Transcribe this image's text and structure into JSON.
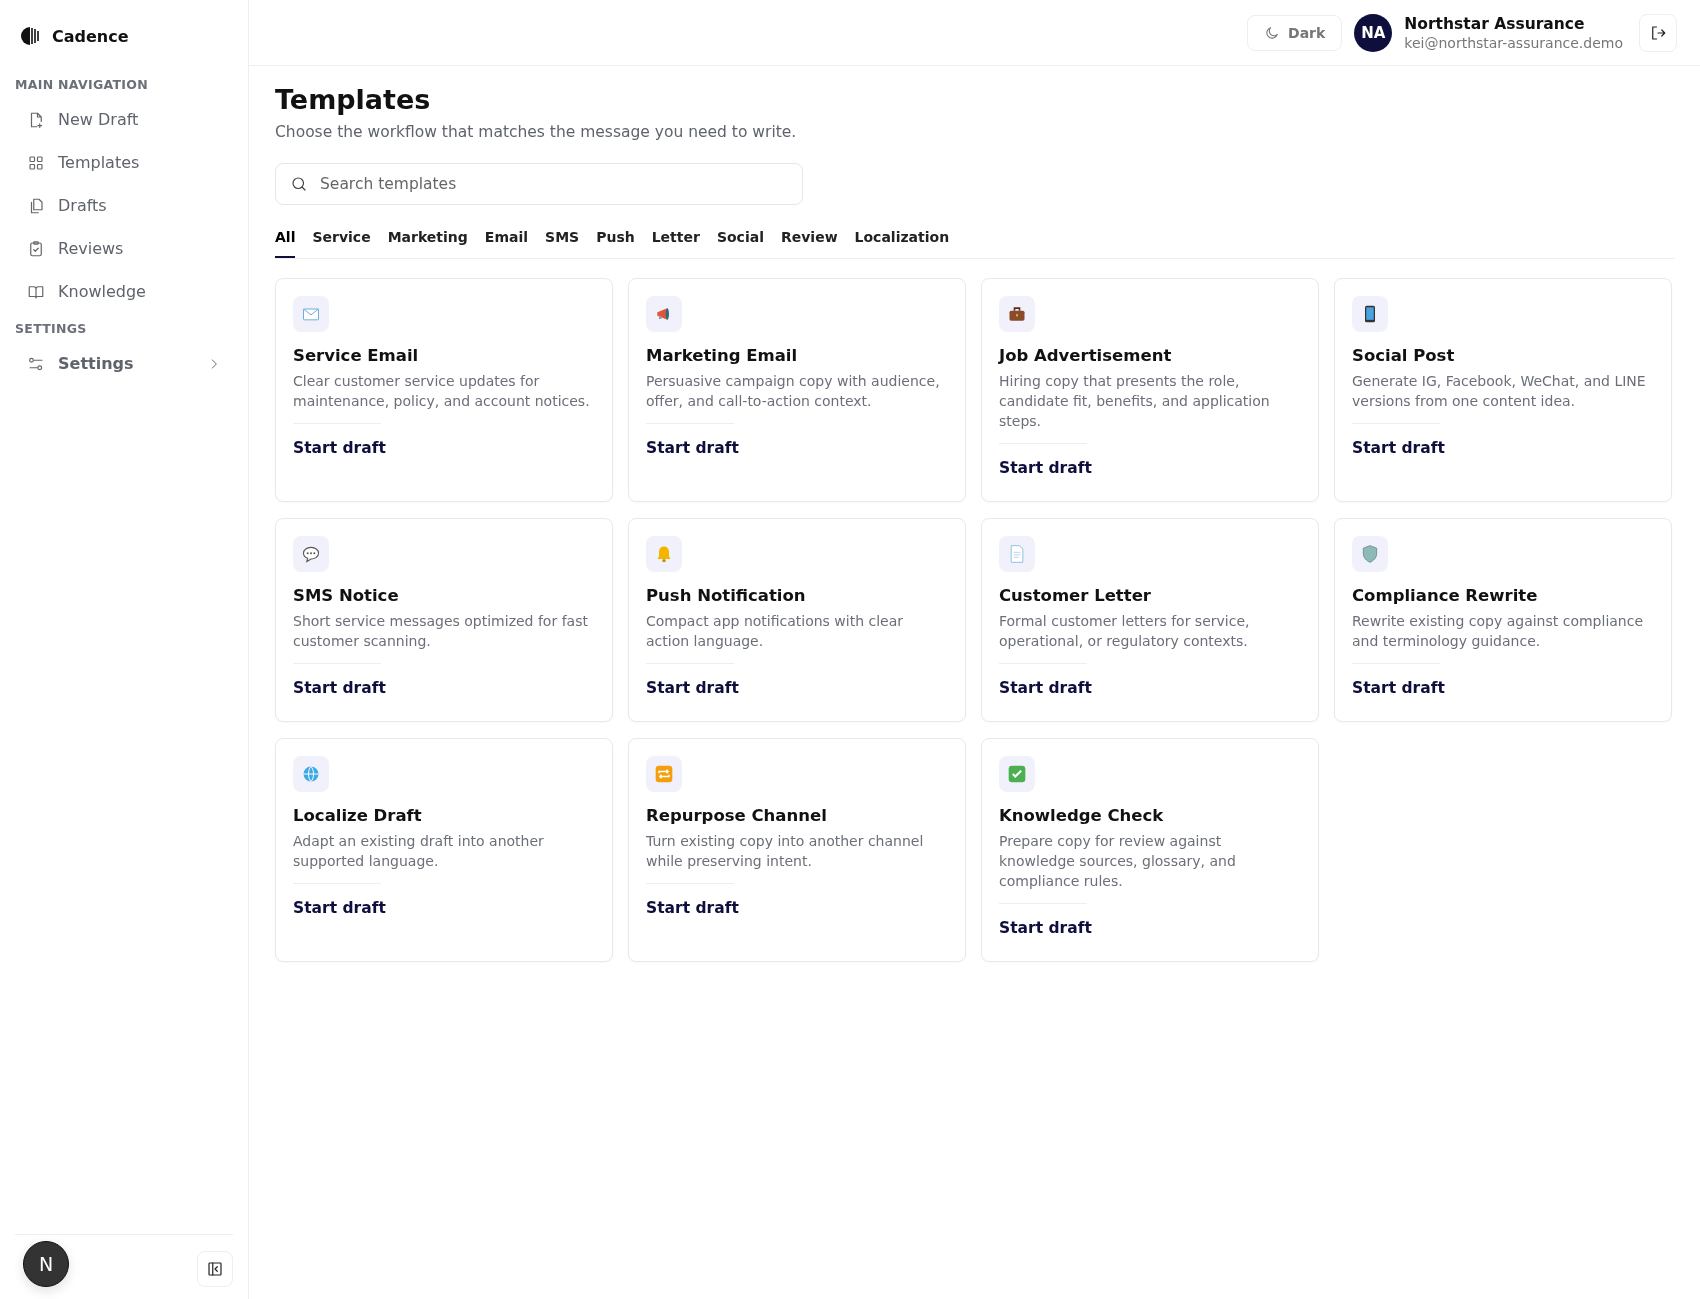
{
  "sidebar": {
    "brand": "Cadence",
    "sections": [
      {
        "heading": "MAIN NAVIGATION",
        "items": [
          {
            "kind": "new-draft",
            "label": "New Draft"
          },
          {
            "kind": "templates",
            "label": "Templates"
          },
          {
            "kind": "drafts",
            "label": "Drafts"
          },
          {
            "kind": "reviews",
            "label": "Reviews"
          },
          {
            "kind": "knowledge",
            "label": "Knowledge"
          }
        ]
      },
      {
        "heading": "SETTINGS",
        "items": [
          {
            "kind": "settings",
            "label": "Settings",
            "expandable": true
          }
        ]
      }
    ],
    "user_avatar": "N"
  },
  "header": {
    "theme_button": "Dark",
    "avatar": "NA",
    "account_name": "Northstar Assurance",
    "account_email": "kei@northstar-assurance.demo"
  },
  "page": {
    "title": "Templates",
    "subtitle": "Choose the workflow that matches the message you need to write.",
    "search": {
      "placeholder": "Search templates"
    },
    "tabs": [
      {
        "label": "All",
        "selected": true
      },
      {
        "label": "Service",
        "selected": false
      },
      {
        "label": "Marketing",
        "selected": false
      },
      {
        "label": "Email",
        "selected": false
      },
      {
        "label": "SMS",
        "selected": false
      },
      {
        "label": "Push",
        "selected": false
      },
      {
        "label": "Letter",
        "selected": false
      },
      {
        "label": "Social",
        "selected": false
      },
      {
        "label": "Review",
        "selected": false
      },
      {
        "label": "Localization",
        "selected": false
      }
    ],
    "cards": [
      {
        "title": "Service Email",
        "description": "Clear customer service updates for maintenance, policy, and account notices.",
        "action": "Start draft"
      },
      {
        "title": "Marketing Email",
        "description": "Persuasive campaign copy with audience, offer, and call-to-action context.",
        "action": "Start draft"
      },
      {
        "title": "Job Advertisement",
        "description": "Hiring copy that presents the role, candidate fit, benefits, and application steps.",
        "action": "Start draft"
      },
      {
        "title": "Social Post",
        "description": "Generate IG, Facebook, WeChat, and LINE versions from one content idea.",
        "action": "Start draft"
      },
      {
        "title": "SMS Notice",
        "description": "Short service messages optimized for fast customer scanning.",
        "action": "Start draft"
      },
      {
        "title": "Push Notification",
        "description": "Compact app notifications with clear action language.",
        "action": "Start draft"
      },
      {
        "title": "Customer Letter",
        "description": "Formal customer letters for service, operational, or regulatory contexts.",
        "action": "Start draft"
      },
      {
        "title": "Compliance Rewrite",
        "description": "Rewrite existing copy against compliance and terminology guidance.",
        "action": "Start draft"
      },
      {
        "title": "Localize Draft",
        "description": "Adapt an existing draft into another supported language.",
        "action": "Start draft"
      },
      {
        "title": "Repurpose Channel",
        "description": "Turn existing copy into another channel while preserving intent.",
        "action": "Start draft"
      },
      {
        "title": "Knowledge Check",
        "description": "Prepare copy for review against knowledge sources, glossary, and compliance rules.",
        "action": "Start draft"
      }
    ]
  }
}
